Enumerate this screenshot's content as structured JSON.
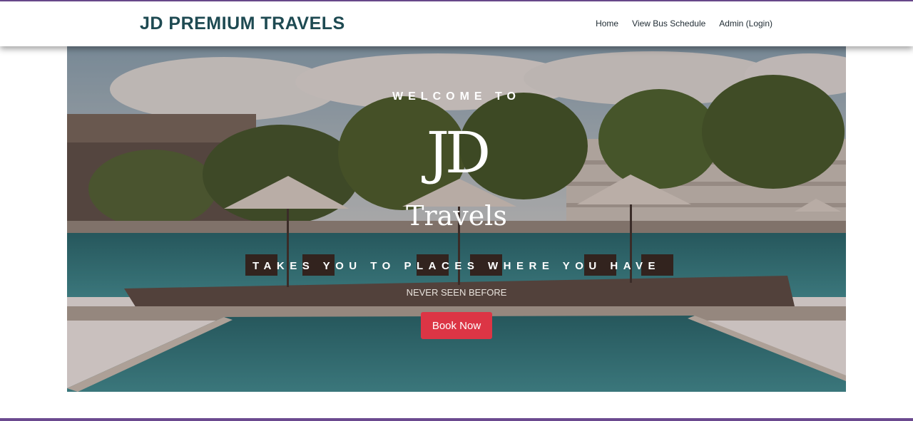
{
  "header": {
    "brand": "JD PREMIUM TRAVELS",
    "nav": [
      {
        "label": "Home"
      },
      {
        "label": "View Bus Schedule"
      },
      {
        "label": "Admin (Login)"
      }
    ]
  },
  "hero": {
    "welcome": "WELCOME TO",
    "logo_monogram": "JD",
    "logo_word": "Travels",
    "tagline": "TAKES YOU TO PLACES WHERE YOU HAVE",
    "subtagline": "NEVER SEEN BEFORE",
    "cta_label": "Book Now"
  },
  "colors": {
    "accent_bar": "#6b4a8f",
    "brand_text": "#1e4a52",
    "cta": "#dc3545"
  }
}
